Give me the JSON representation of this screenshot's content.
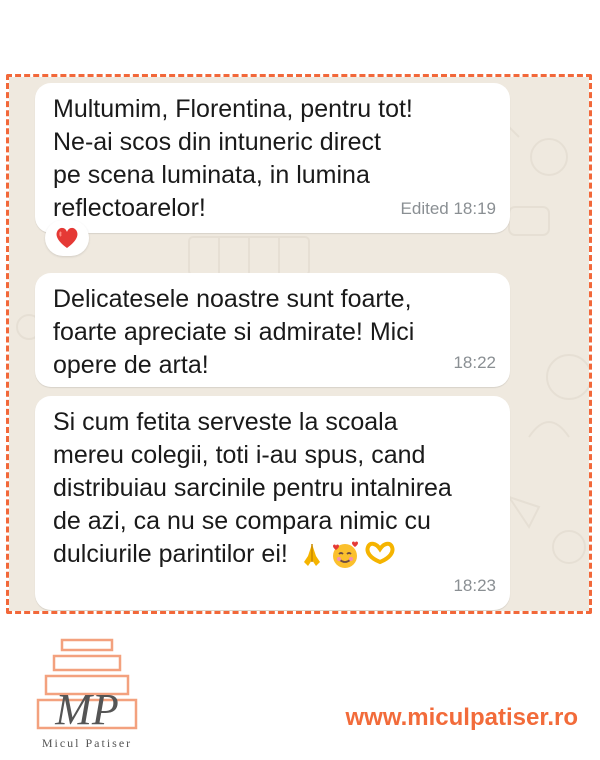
{
  "messages": [
    {
      "text": "Multumim, Florentina, pentru tot!\nNe-ai scos din intuneric direct\npe scena luminata, in lumina\nreflectoarelor!",
      "time": "Edited 18:19",
      "reaction": "heart-emoji"
    },
    {
      "text_before": "Delicatesele noastre sunt foarte,\n",
      "text_highlight": "foarte apreciate",
      "text_after": " si admirate! Mici\nopere de arta!",
      "time": "18:22"
    },
    {
      "text": "Si cum fetita serveste la scoala\nmereu colegii, toti i-au spus, cand\ndistribuiau sarcinile pentru intalnirea\nde azi, ca nu se compara nimic cu\ndulciurile parintilor ei!",
      "emojis": [
        "folded-hands-emoji",
        "smiling-face-with-hearts-emoji",
        "heart-hands-emoji"
      ],
      "time": "18:23"
    }
  ],
  "brand": {
    "logo_monogram": "MP",
    "logo_name": "Micul Patiser",
    "website": "www.miculpatiser.ro"
  },
  "colors": {
    "accent": "#f26b3a",
    "chat_bg": "#efe9df",
    "bubble_bg": "#ffffff",
    "time_text": "#8a8f93"
  }
}
